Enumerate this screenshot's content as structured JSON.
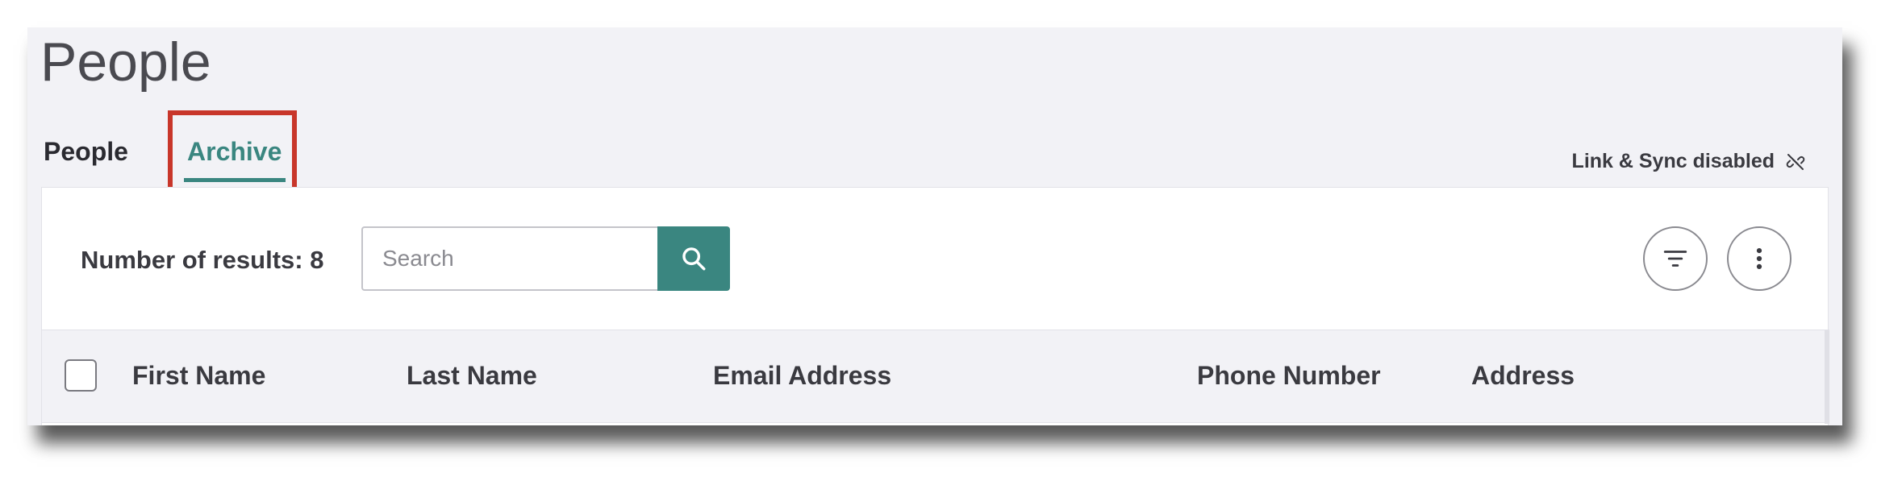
{
  "page": {
    "title": "People"
  },
  "tabs": [
    {
      "label": "People",
      "active": false
    },
    {
      "label": "Archive",
      "active": true
    }
  ],
  "sync_status": {
    "label": "Link & Sync disabled",
    "icon": "link-off-icon"
  },
  "toolbar": {
    "results_label": "Number of results: 8",
    "search_placeholder": "Search",
    "search_value": "",
    "search_icon": "search-icon",
    "filter_icon": "filter-icon",
    "more_icon": "more-vertical-icon"
  },
  "table": {
    "columns": [
      "First Name",
      "Last Name",
      "Email Address",
      "Phone Number",
      "Address"
    ]
  },
  "colors": {
    "accent": "#3a8680",
    "highlight": "#c8362a",
    "background": "#f2f2f6",
    "text": "#3a3a40"
  }
}
